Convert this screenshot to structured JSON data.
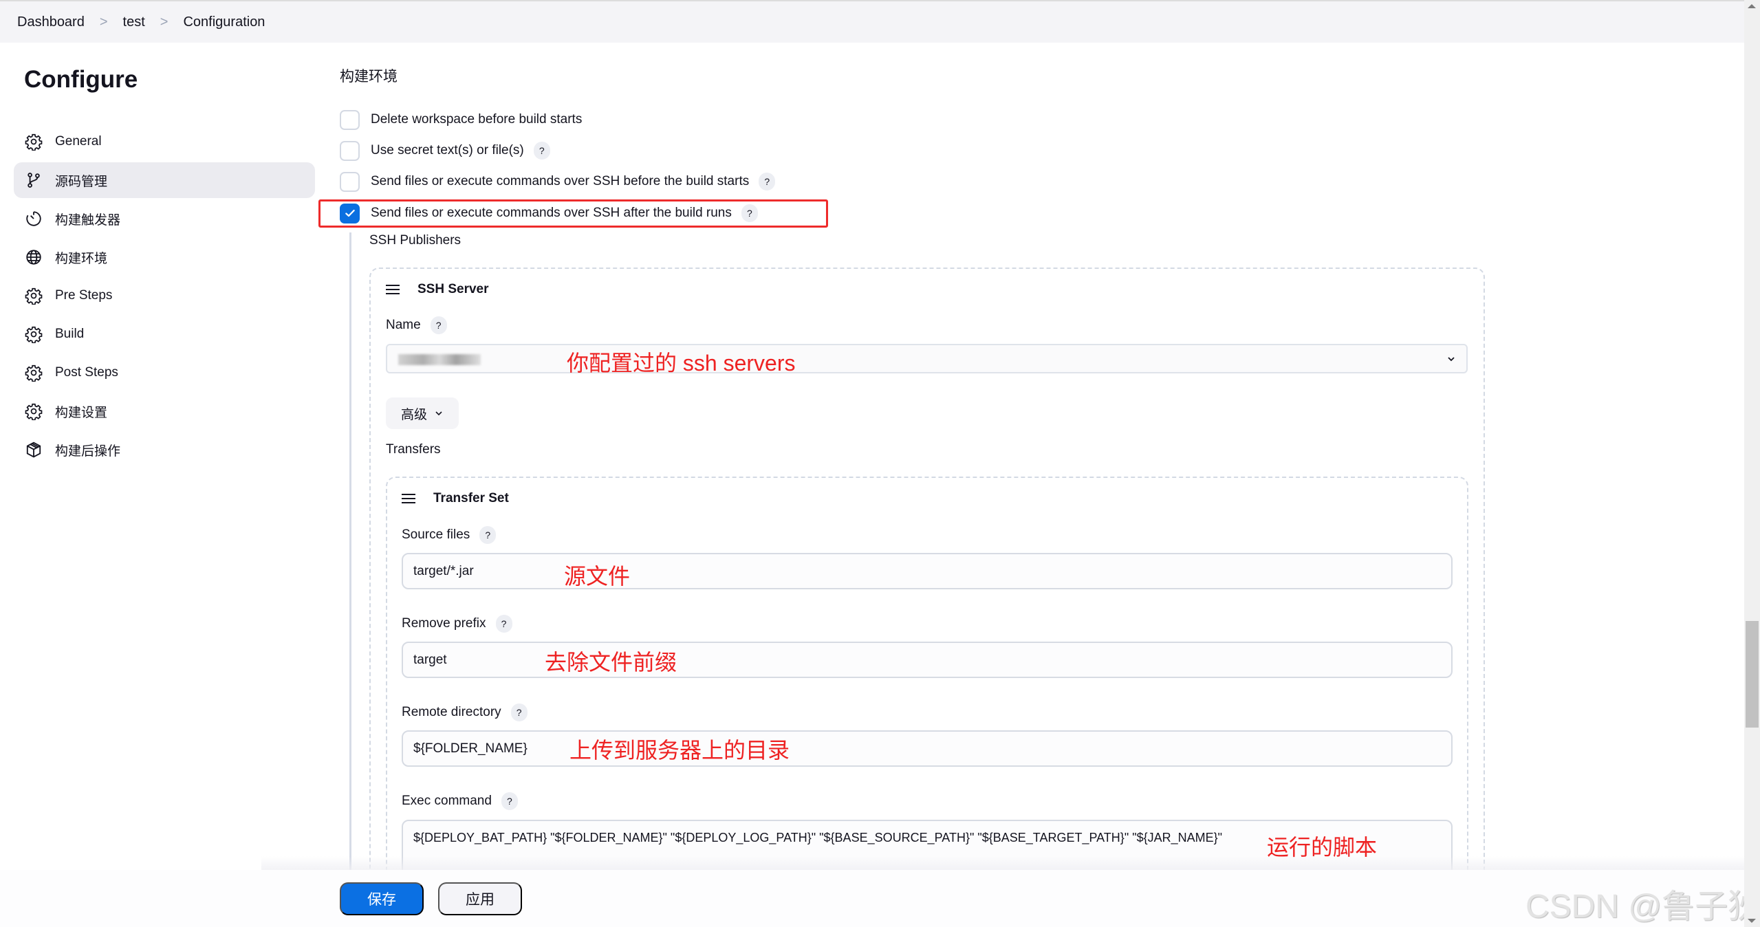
{
  "breadcrumb": {
    "items": [
      "Dashboard",
      "test",
      "Configuration"
    ],
    "separator": ">"
  },
  "page": {
    "title": "Configure"
  },
  "sidebar": {
    "items": [
      {
        "label": "General",
        "icon": "gear-icon",
        "active": false
      },
      {
        "label": "源码管理",
        "icon": "branch-icon",
        "active": true
      },
      {
        "label": "构建触发器",
        "icon": "timer-icon",
        "active": false
      },
      {
        "label": "构建环境",
        "icon": "globe-icon",
        "active": false
      },
      {
        "label": "Pre Steps",
        "icon": "gear-icon",
        "active": false
      },
      {
        "label": "Build",
        "icon": "gear-icon",
        "active": false
      },
      {
        "label": "Post Steps",
        "icon": "gear-icon",
        "active": false
      },
      {
        "label": "构建设置",
        "icon": "gear-icon",
        "active": false
      },
      {
        "label": "构建后操作",
        "icon": "package-icon",
        "active": false
      }
    ]
  },
  "section": {
    "title": "构建环境",
    "checkboxes": [
      {
        "label": "Delete workspace before build starts",
        "checked": false,
        "help": false
      },
      {
        "label": "Use secret text(s) or file(s)",
        "checked": false,
        "help": true
      },
      {
        "label": "Send files or execute commands over SSH before the build starts",
        "checked": false,
        "help": true
      },
      {
        "label": "Send files or execute commands over SSH after the build runs",
        "checked": true,
        "help": true
      }
    ],
    "help_glyph": "?"
  },
  "ssh": {
    "publishers_label": "SSH Publishers",
    "server_header": "SSH Server",
    "name_label": "Name",
    "name_value_obscured": true,
    "advanced_label": "高级",
    "transfers_label": "Transfers",
    "transfer_set": {
      "header": "Transfer Set",
      "source_files_label": "Source files",
      "source_files_value": "target/*.jar",
      "remove_prefix_label": "Remove prefix",
      "remove_prefix_value": "target",
      "remote_directory_label": "Remote directory",
      "remote_directory_value": "${FOLDER_NAME}",
      "exec_command_label": "Exec command",
      "exec_command_value": "${DEPLOY_BAT_PATH} \"${FOLDER_NAME}\" \"${DEPLOY_LOG_PATH}\" \"${BASE_SOURCE_PATH}\" \"${BASE_TARGET_PATH}\" \"${JAR_NAME}\""
    }
  },
  "annotations": {
    "name": "你配置过的 ssh servers",
    "source_files": "源文件",
    "remove_prefix": "去除文件前缀",
    "remote_directory": "上传到服务器上的目录",
    "exec_command": "运行的脚本"
  },
  "footer": {
    "save_label": "保存",
    "apply_label": "应用"
  },
  "watermark": "CSDN @鲁子狄",
  "colors": {
    "primary": "#0b70e3",
    "annotation_red": "#ee2222",
    "highlight_bg": "#ebebf0"
  }
}
